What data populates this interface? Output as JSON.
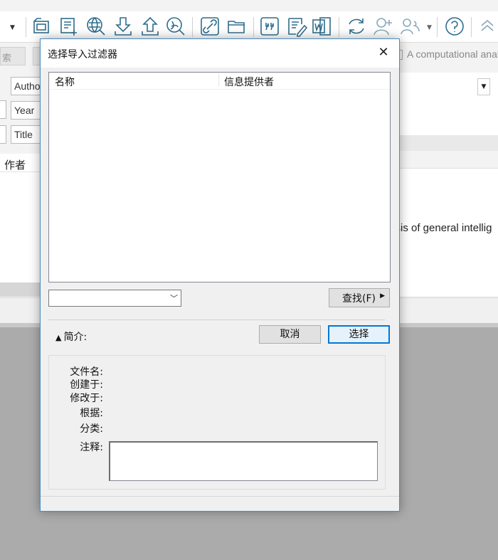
{
  "dialog": {
    "title": "选择导入过滤器",
    "close_label": "✕",
    "columns": [
      "名称",
      "信息提供者"
    ],
    "combo_value": "",
    "find_label": "查找(F)",
    "brief_label": "简介:",
    "cancel_label": "取消",
    "select_label": "选择",
    "info_labels": {
      "filename": "文件名:",
      "created": "创建于:",
      "modified": "修改于:",
      "based_on": "根据:",
      "category": "分类:",
      "comment": "注释:"
    }
  },
  "background": {
    "fields": [
      "Autho",
      "Year",
      "Title"
    ],
    "column_header": "作者",
    "right_title": "A computational anal",
    "right_text": "ysis of general intellig"
  },
  "toolbar": {
    "icons": [
      "dropdown-arrow-icon",
      "new-group-icon",
      "new-reference-icon",
      "online-search-icon",
      "import-icon",
      "export-icon",
      "find-pdf-icon",
      "link-icon",
      "open-folder-icon",
      "quote-icon",
      "edit-document-icon",
      "word-icon",
      "sync-icon",
      "share-user-icon",
      "share-group-icon",
      "help-icon",
      "collapse-icon"
    ]
  },
  "colors": {
    "accent": "#0078d7",
    "icon": "#2f6d8c",
    "dialog_border": "#4a8dbf"
  }
}
